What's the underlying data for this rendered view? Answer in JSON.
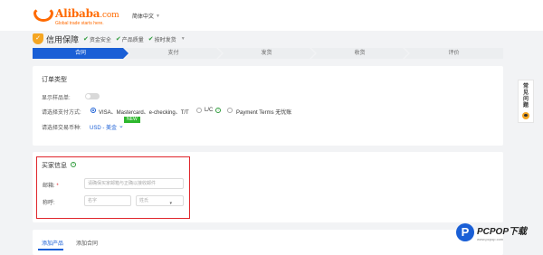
{
  "header": {
    "logo_name": "Alibaba",
    "logo_suffix": ".com",
    "logo_tagline": "Global trade starts here.",
    "language": "简体中文"
  },
  "titlebar": {
    "title": "信用保障",
    "features": [
      "资金安全",
      "产品质量",
      "按时发货"
    ]
  },
  "steps": [
    "合同",
    "支付",
    "发货",
    "收货",
    "评价"
  ],
  "order_type": {
    "section_title": "订单类型",
    "sample_label": "显示样品单:",
    "payment_label": "请选择支付方式:",
    "payment_options": [
      "VISA、Mastercard、e-checking、T/T",
      "L/C",
      "Payment Terms 无忧账"
    ],
    "currency_label": "请选择交易币种:",
    "currency_value": "USD - 美金",
    "new_badge": "NEW"
  },
  "buyer_info": {
    "section_title": "买家信息",
    "email_label": "邮箱:",
    "email_placeholder": "请确保买家邮箱与正确以接收邮件",
    "name_label": "称呼:",
    "first_name_placeholder": "名字",
    "last_name_placeholder": "姓氏"
  },
  "tabs": [
    "添加产品",
    "添加合同"
  ],
  "side_widget": {
    "label": "常见问题"
  },
  "watermark": {
    "text": "PCPOP下载",
    "sub": "www.pcpop.com"
  },
  "colors": {
    "brand_orange": "#ff6a00",
    "primary_blue": "#1a5fd6",
    "highlight_red": "#e0262b",
    "new_green": "#2eb82e"
  }
}
